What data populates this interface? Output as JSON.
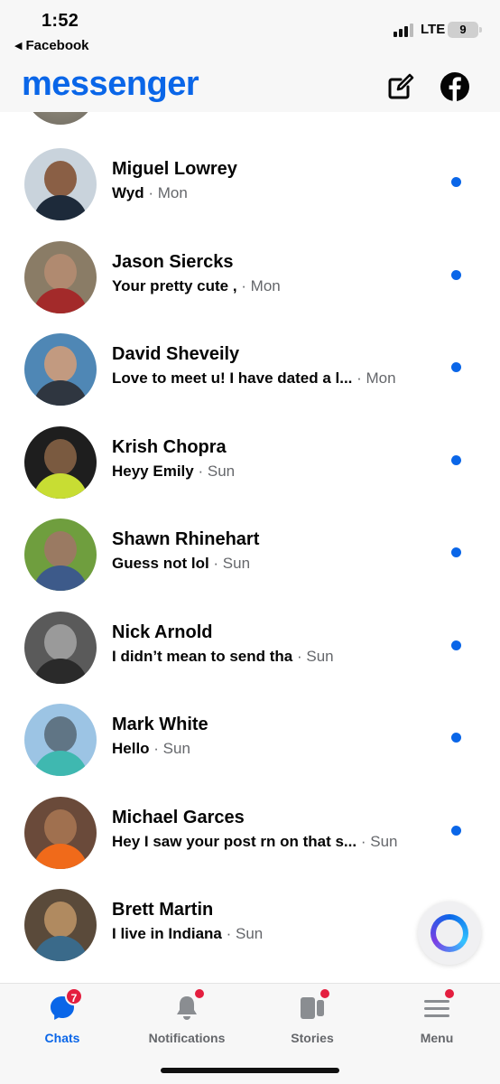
{
  "status_bar": {
    "time": "1:52",
    "back_app": "Facebook",
    "network": "LTE",
    "battery": "9"
  },
  "header": {
    "brand": "messenger",
    "compose_icon": "compose-icon",
    "facebook_icon": "facebook-icon"
  },
  "accent_color": "#0a66e8",
  "unread_color": "#0a66e8",
  "chats": [
    {
      "name": "Miguel Lowrey",
      "message": "Wyd",
      "time": "· Mon",
      "unread": true,
      "avatar_colors": [
        "#c9d3dc",
        "#8a5f45",
        "#1d2a3a"
      ]
    },
    {
      "name": "Jason Siercks",
      "message": "Your pretty cute ,",
      "time": "· Mon",
      "unread": true,
      "avatar_colors": [
        "#8a7c66",
        "#b08a70",
        "#a32a2a"
      ]
    },
    {
      "name": "David Sheveily",
      "message": "Love to meet u!  I have dated a l...",
      "time": "· Mon",
      "unread": true,
      "avatar_colors": [
        "#4f87b5",
        "#c29a80",
        "#2f3640"
      ]
    },
    {
      "name": "Krish Chopra",
      "message": "Heyy Emily",
      "time": "· Sun",
      "unread": true,
      "avatar_colors": [
        "#1e1e1e",
        "#7a5a40",
        "#c8dd33"
      ]
    },
    {
      "name": "Shawn Rhinehart",
      "message": "Guess not lol",
      "time": "· Sun",
      "unread": true,
      "avatar_colors": [
        "#6f9e3e",
        "#9a7a62",
        "#3d5a8a"
      ]
    },
    {
      "name": "Nick Arnold",
      "message": "I didn’t mean to send tha",
      "time": "· Sun",
      "unread": true,
      "avatar_colors": [
        "#5a5a5a",
        "#9a9a9a",
        "#2a2a2a"
      ]
    },
    {
      "name": "Mark White",
      "message": "Hello",
      "time": "· Sun",
      "unread": true,
      "avatar_colors": [
        "#9cc4e4",
        "#607585",
        "#3fb8b0"
      ]
    },
    {
      "name": "Michael Garces",
      "message": "Hey I saw your post rn on that s...",
      "time": "· Sun",
      "unread": true,
      "avatar_colors": [
        "#6a4a3a",
        "#a0704f",
        "#f06a1a"
      ]
    },
    {
      "name": "Brett Martin",
      "message": "I live in Indiana",
      "time": "· Sun",
      "unread": false,
      "avatar_colors": [
        "#5a4a3a",
        "#b08a60",
        "#3a6a8a"
      ]
    }
  ],
  "tabs": [
    {
      "label": "Chats",
      "icon": "chat-bubble-icon",
      "badge": "7",
      "active": true
    },
    {
      "label": "Notifications",
      "icon": "bell-icon",
      "badge_dot": true,
      "active": false
    },
    {
      "label": "Stories",
      "icon": "stories-icon",
      "badge_dot": true,
      "active": false
    },
    {
      "label": "Menu",
      "icon": "hamburger-menu-icon",
      "badge_dot": true,
      "active": false
    }
  ]
}
